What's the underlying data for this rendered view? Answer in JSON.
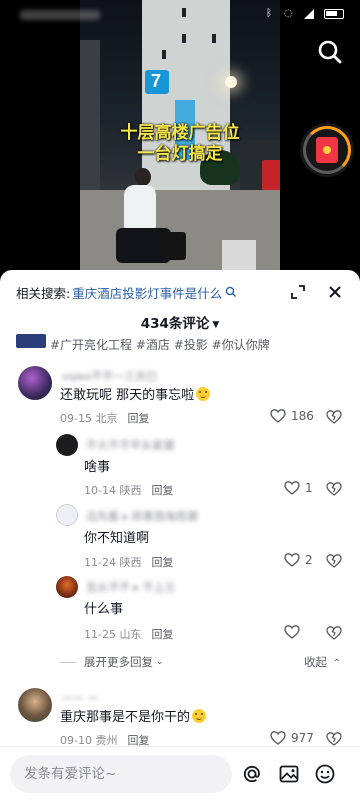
{
  "video": {
    "overlay_line1": "十层高楼广告位",
    "overlay_line2": "一台灯搞定"
  },
  "sheet": {
    "related_label": "相关搜索:",
    "related_query": "重庆酒店投影灯事件是什么",
    "comment_count": "434条评论"
  },
  "tags_line": "#广开亮化工程 #酒店 #投影 #你认你牌",
  "comments": [
    {
      "author": "vqwe不不一三天已",
      "text": "还敢玩呢 那天的事忘啦",
      "date_location": "09-15 北京",
      "reply_label": "回复",
      "likes": "186"
    },
    {
      "author": "不大不不平头家潮",
      "text": "啥事",
      "date_location": "10-14 陕西",
      "reply_label": "回复",
      "likes": "1"
    },
    {
      "author": "迅先看 ▸ 异果渤海观潮",
      "text": "你不知道啊",
      "date_location": "11-24 陕西",
      "reply_label": "回复",
      "likes": "2"
    },
    {
      "author": "至从不不 ▸ 不上兰",
      "text": "什么事",
      "date_location": "11-25 山东",
      "reply_label": "回复",
      "likes": ""
    },
    {
      "author": "一一 一",
      "text": "重庆那事是不是你干的",
      "date_location": "09-10 贵州",
      "reply_label": "回复",
      "likes": "977"
    }
  ],
  "expand_more": "展开更多回复",
  "collapse": "收起",
  "input": {
    "placeholder": "发条有爱评论~"
  },
  "icons": {
    "status": [
      "bluetooth-icon",
      "mute-icon",
      "signal-icon",
      "battery-icon"
    ],
    "top": [
      "search-icon",
      "red-packet-icon"
    ],
    "sheet": [
      "expand-icon",
      "close-icon"
    ],
    "comment": [
      "heart-icon",
      "dislike-icon"
    ],
    "input": [
      "at-icon",
      "image-icon",
      "emoji-icon"
    ]
  },
  "colors": {
    "overlay_text": "#f5e64a",
    "related_query": "#2b5ea8",
    "red_packet": "#f23545"
  }
}
